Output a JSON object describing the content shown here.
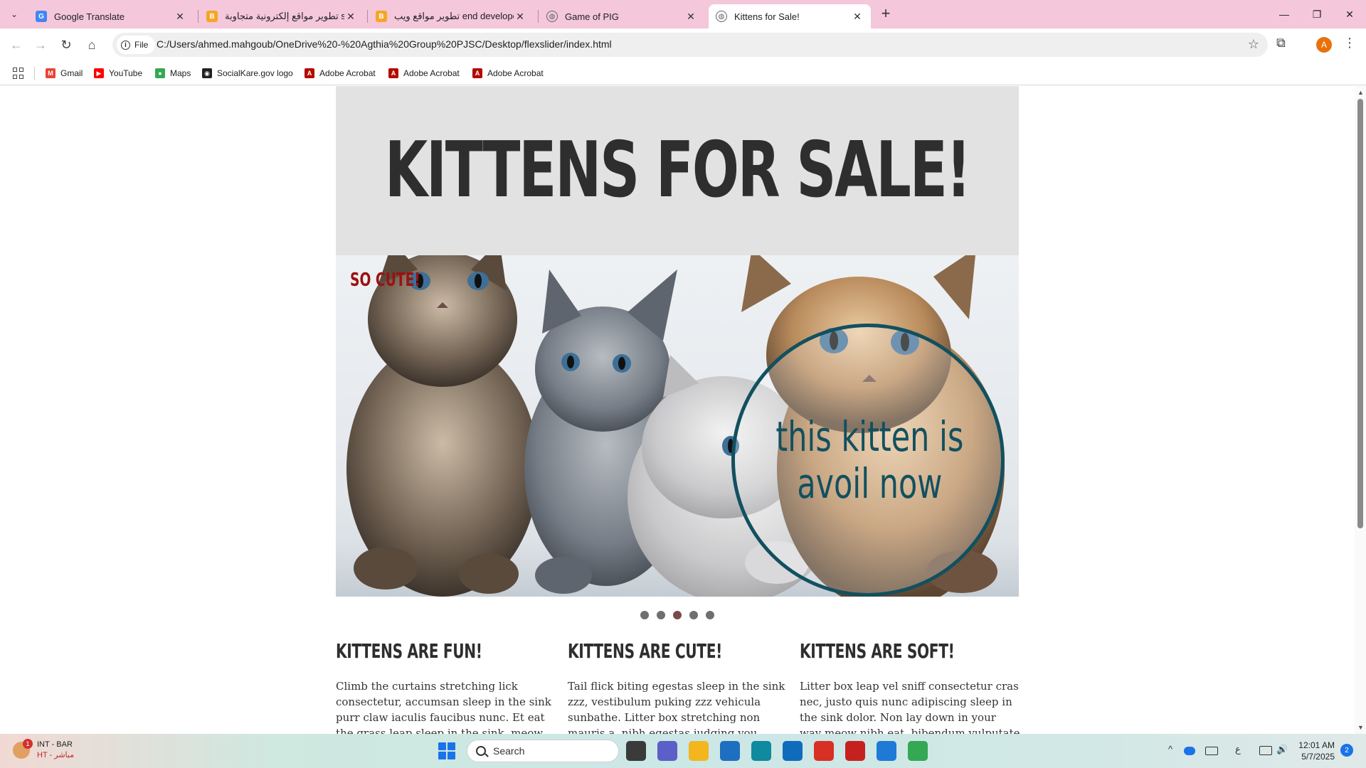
{
  "browser": {
    "tabs": [
      {
        "title": "Google Translate",
        "icon": "google-translate-icon",
        "color": "#4285f4"
      },
      {
        "title": "تطوير مواقع إلكترونية متجاوبة ser",
        "icon": "blogger-icon",
        "color": "#f5a623"
      },
      {
        "title": "تطوير مواقع ويب end developer",
        "icon": "blogger-icon",
        "color": "#f5a623"
      },
      {
        "title": "Game of PIG",
        "icon": "globe-icon",
        "color": "#5f6368"
      },
      {
        "title": "Kittens for Sale!",
        "icon": "globe-icon",
        "color": "#5f6368"
      }
    ],
    "new_tab": "+",
    "window_controls": {
      "minimize": "—",
      "restore": "❐",
      "close": "✕"
    },
    "toolbar": {
      "back": "←",
      "forward": "→",
      "reload": "↻",
      "home": "⌂",
      "chip_label": "File",
      "url": "C:/Users/ahmed.mahgoub/OneDrive%20-%20Agthia%20Group%20PJSC/Desktop/flexslider/index.html",
      "star": "☆",
      "extensions": "⧉",
      "profile_initial": "A",
      "menu": "⋮"
    },
    "bookmarks": [
      {
        "label": "Gmail",
        "icon": "gmail-icon",
        "color": "#ea4335",
        "glyph": "M"
      },
      {
        "label": "YouTube",
        "icon": "youtube-icon",
        "color": "#ff0000",
        "glyph": "▶"
      },
      {
        "label": "Maps",
        "icon": "maps-icon",
        "color": "#34a853",
        "glyph": "●"
      },
      {
        "label": "SocialKare.gov logo",
        "icon": "socialkare-icon",
        "color": "#202124",
        "glyph": "◉"
      },
      {
        "label": "Adobe Acrobat",
        "icon": "adobe-acrobat-icon",
        "color": "#b30b00",
        "glyph": "A"
      },
      {
        "label": "Adobe Acrobat",
        "icon": "adobe-acrobat-icon",
        "color": "#b30b00",
        "glyph": "A"
      },
      {
        "label": "Adobe Acrobat",
        "icon": "adobe-acrobat-icon",
        "color": "#b30b00",
        "glyph": "A"
      }
    ]
  },
  "page": {
    "title": "KITTENS FOR SALE!",
    "slider": {
      "caption": "SO CUTE!",
      "promo": "this kitten is\navoil now",
      "slide_count": 5,
      "active_slide": 3
    },
    "features": [
      {
        "heading": "KITTENS ARE FUN!",
        "body": "Climb the curtains stretching lick consectetur, accumsan sleep in the sink purr claw iaculis faucibus nunc. Et eat the grass leap sleep in the sink, meow in viverra tempus tristique"
      },
      {
        "heading": "KITTENS ARE CUTE!",
        "body": "Tail flick biting egestas sleep in the sink zzz, vestibulum puking zzz vehicula sunbathe. Litter box stretching non mauris a, nibh egestas judging you sollicitudin eat the grass"
      },
      {
        "heading": "KITTENS ARE SOFT!",
        "body": "Litter box leap vel sniff consectetur cras nec, justo quis nunc adipiscing sleep in the sink dolor. Non lay down in your way meow nibh eat, bibendum vulputate enim lick fluffy fur."
      }
    ],
    "colors": {
      "header_bg": "#e2e2e2",
      "title": "#2e2e2e",
      "caption": "#9b1111",
      "promo": "#12505f"
    }
  },
  "taskbar": {
    "weather": {
      "badge": "1",
      "line1": "INT - BAR",
      "line2": "HT - مباشر"
    },
    "search_placeholder": "Search",
    "apps": [
      {
        "name": "task-view-icon",
        "color": "#3a3a3a"
      },
      {
        "name": "teams-icon",
        "color": "#5b5fc7"
      },
      {
        "name": "file-explorer-icon",
        "color": "#f3b61f"
      },
      {
        "name": "store-icon",
        "color": "#1e6fbf"
      },
      {
        "name": "edge-icon",
        "color": "#0f8a9e"
      },
      {
        "name": "outlook-icon",
        "color": "#0f6cbd"
      },
      {
        "name": "pdf-icon",
        "color": "#d93025"
      },
      {
        "name": "acrobat-icon",
        "color": "#c5221f"
      },
      {
        "name": "vscode-icon",
        "color": "#1f7ad6"
      },
      {
        "name": "chrome-icon",
        "color": "#34a853"
      }
    ],
    "tray": {
      "chevron": "^",
      "lang": "ع"
    },
    "time": "12:01 AM",
    "date": "5/7/2025",
    "notifications": "2"
  }
}
